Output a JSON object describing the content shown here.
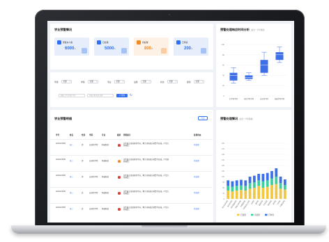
{
  "overview": {
    "title": "学业预警情况",
    "tiles": [
      {
        "label": "预警总人数",
        "value": "6000",
        "unit": "人",
        "bg": "#e7eefb",
        "accent": "#2f6ff0",
        "value_color": "#2f6ff0"
      },
      {
        "label": "已处理",
        "value": "5000",
        "unit": "人",
        "bg": "#e7eefb",
        "accent": "#2f6ff0",
        "value_color": "#2f6ff0"
      },
      {
        "label": "待处理",
        "value": "800",
        "unit": "人",
        "bg": "#fdf0e4",
        "accent": "#f08a24",
        "value_color": "#f08a24"
      },
      {
        "label": "已申诉",
        "value": "200",
        "unit": "人",
        "bg": "#e7eefb",
        "accent": "#2f6ff0",
        "value_color": "#2f6ff0"
      }
    ]
  },
  "filters": {
    "items": [
      {
        "label": "年级",
        "value": "全部"
      },
      {
        "label": "学院",
        "value": "全部"
      },
      {
        "label": "专业",
        "value": "全部"
      },
      {
        "label": "班级",
        "value": "全部"
      },
      {
        "label": "状态",
        "value": "全部"
      },
      {
        "label": "级别",
        "value": "全部"
      }
    ],
    "search_placeholder": "请输入学生姓名/学号",
    "date_placeholder": "开始日期-结束日期",
    "query_label": "查询",
    "reset_icon": "refresh-icon"
  },
  "detail": {
    "title": "学业预警明细",
    "export_label": "导出",
    "columns": [
      "学号",
      "姓名",
      "性别",
      "学院",
      "专业",
      "级别",
      "预警提示",
      "处理状态"
    ],
    "rows": [
      {
        "id": "2019121545",
        "name": "张三",
        "gender": "男",
        "college": "自动化学院",
        "major": "机械制造",
        "level_color": "#e53935",
        "tip": "该生截止目前获得学分，累计挂科超过预警学分线，产生红色预警。",
        "status": "待处理"
      },
      {
        "id": "2019121545",
        "name": "张三",
        "gender": "男",
        "college": "自动化学院",
        "major": "机械制造",
        "level_color": "#f08a24",
        "tip": "该生截止目前获得学分，累计挂科超过预警学分线，产生橙色预警。",
        "status": "待处理"
      },
      {
        "id": "2019121545",
        "name": "张三",
        "gender": "男",
        "college": "自动化学院",
        "major": "机械制造",
        "level_color": "#e53935",
        "tip": "该生截止目前获得学分，累计挂科超过预警学分线，产生红色预警。",
        "status": "待处理"
      },
      {
        "id": "2019121545",
        "name": "张三",
        "gender": "女",
        "college": "自动化学院",
        "major": "机械制造",
        "level_color": "#e53935",
        "tip": "该生截止目前获得学分，累计挂科超过预警学分线，产生红色预警。",
        "status": "待处理"
      },
      {
        "id": "2019121545",
        "name": "张三",
        "gender": "女",
        "college": "自动化学院",
        "major": "机械制造",
        "level_color": "#e53935",
        "tip": "该生截止目前获得学分，累计挂科超过预警学分线，产生红色预警。",
        "status": "待处理"
      }
    ]
  },
  "box_chart": {
    "title": "预警处理响应时间分析",
    "subtitle": "(最近一学年数据)"
  },
  "bar_chart": {
    "title": "预警处理情况",
    "subtitle": "(最近一学年数据)"
  },
  "chart_data": [
    {
      "type": "box",
      "categories": [
        "辽学院学院",
        "电信学院学院",
        "自动化学院",
        "机械学院学院"
      ],
      "boxes": [
        {
          "min": 25,
          "q1": 30,
          "median": 40,
          "q3": 45,
          "max": 55
        },
        {
          "min": 30,
          "q1": 33,
          "median": 36,
          "q3": 40,
          "max": 45
        },
        {
          "min": 40,
          "q1": 45,
          "median": 60,
          "q3": 70,
          "max": 85
        },
        {
          "min": 65,
          "q1": 70,
          "median": 80,
          "q3": 85,
          "max": 95
        }
      ],
      "ylim": [
        0,
        100
      ],
      "yticks": [
        0,
        20,
        40,
        60,
        80,
        100
      ],
      "color": "#3d6fe6"
    },
    {
      "type": "bar",
      "stacked": true,
      "categories": [
        "电子信息学院",
        "自动化学院",
        "经济管理学院",
        "机械工程学院",
        "外国语学院",
        "马克思主义学院",
        "法学院",
        "理学院",
        "建筑学院",
        "艺术学院",
        "体育学院",
        "医学院",
        "文学院",
        "计算机学院"
      ],
      "series": [
        {
          "name": "已处理",
          "color": "#f2c744",
          "values": [
            45,
            40,
            45,
            48,
            45,
            55,
            60,
            70,
            60,
            65,
            75,
            80,
            55,
            50
          ]
        },
        {
          "name": "待处理",
          "color": "#3ccf9f",
          "values": [
            25,
            25,
            25,
            25,
            25,
            30,
            30,
            30,
            35,
            35,
            35,
            40,
            30,
            25
          ]
        },
        {
          "name": "已申诉",
          "color": "#3d6fe6",
          "values": [
            30,
            30,
            30,
            30,
            30,
            35,
            35,
            35,
            40,
            40,
            40,
            45,
            35,
            30
          ]
        }
      ],
      "ylim": [
        0,
        300
      ],
      "yticks": [
        0,
        30,
        60,
        90,
        120,
        150,
        180,
        210,
        240,
        270,
        300
      ]
    }
  ]
}
